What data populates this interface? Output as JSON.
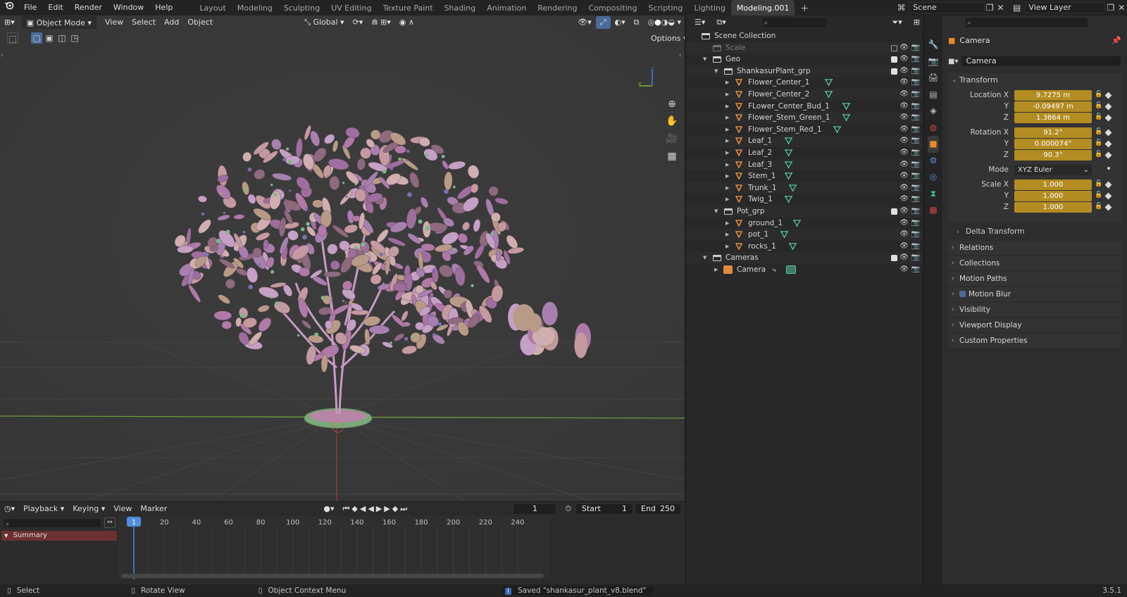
{
  "menu": {
    "file": "File",
    "edit": "Edit",
    "render": "Render",
    "window": "Window",
    "help": "Help"
  },
  "workspaces": [
    "Layout",
    "Modeling",
    "Sculpting",
    "UV Editing",
    "Texture Paint",
    "Shading",
    "Animation",
    "Rendering",
    "Compositing",
    "Scripting",
    "Lighting",
    "Modeling.001"
  ],
  "active_workspace": "Modeling.001",
  "scene_name": "Scene",
  "view_layer": "View Layer",
  "viewport": {
    "mode": "Object Mode",
    "menus": [
      "View",
      "Select",
      "Add",
      "Object"
    ],
    "transform_orientation": "Global",
    "options_label": "Options",
    "axis_x_label": "y",
    "axis_z_label": "z"
  },
  "timeline": {
    "menus": [
      "Playback",
      "Keying",
      "View",
      "Marker"
    ],
    "current_frame": "1",
    "start_label": "Start",
    "start_value": "1",
    "end_label": "End",
    "end_value": "250",
    "ruler": [
      "20",
      "40",
      "60",
      "80",
      "100",
      "120",
      "140",
      "160",
      "180",
      "200",
      "220",
      "240"
    ],
    "current_frame_marker": "1",
    "summary_label": "Summary"
  },
  "outliner": {
    "rows": [
      {
        "label": "Scene Collection",
        "type": "scene",
        "indent": 0
      },
      {
        "label": "Scale",
        "type": "collection-disabled",
        "indent": 1
      },
      {
        "label": "Geo",
        "type": "collection",
        "indent": 1
      },
      {
        "label": "ShankasurPlant_grp",
        "type": "collection",
        "indent": 2
      },
      {
        "label": "Flower_Center_1",
        "type": "mesh",
        "indent": 3
      },
      {
        "label": "Flower_Center_2",
        "type": "mesh",
        "indent": 3
      },
      {
        "label": "FLower_Center_Bud_1",
        "type": "mesh",
        "indent": 3
      },
      {
        "label": "Flower_Stem_Green_1",
        "type": "mesh",
        "indent": 3
      },
      {
        "label": "Flower_Stem_Red_1",
        "type": "mesh",
        "indent": 3
      },
      {
        "label": "Leaf_1",
        "type": "mesh",
        "indent": 3
      },
      {
        "label": "Leaf_2",
        "type": "mesh",
        "indent": 3
      },
      {
        "label": "Leaf_3",
        "type": "mesh",
        "indent": 3
      },
      {
        "label": "Stem_1",
        "type": "mesh",
        "indent": 3
      },
      {
        "label": "Trunk_1",
        "type": "mesh",
        "indent": 3
      },
      {
        "label": "Twig_1",
        "type": "mesh",
        "indent": 3
      },
      {
        "label": "Pot_grp",
        "type": "collection",
        "indent": 2
      },
      {
        "label": "ground_1",
        "type": "mesh",
        "indent": 3
      },
      {
        "label": "pot_1",
        "type": "mesh",
        "indent": 3
      },
      {
        "label": "rocks_1",
        "type": "mesh",
        "indent": 3
      },
      {
        "label": "Cameras",
        "type": "collection",
        "indent": 1
      },
      {
        "label": "Camera",
        "type": "camera",
        "indent": 2
      }
    ]
  },
  "properties": {
    "object_name": "Camera",
    "data_name": "Camera",
    "transform_label": "Transform",
    "location_label": "Location X",
    "location": [
      "9.7275 m",
      "-0.09497 m",
      "1.3864 m"
    ],
    "rotation_label": "Rotation X",
    "rotation": [
      "91.2°",
      "0.000074°",
      "90.3°"
    ],
    "mode_label": "Mode",
    "mode_value": "XYZ Euler",
    "scale_label": "Scale X",
    "scale": [
      "1.000",
      "1.000",
      "1.000"
    ],
    "axis_y": "Y",
    "axis_z": "Z",
    "delta_transform": "Delta Transform",
    "panels": [
      "Relations",
      "Collections",
      "Motion Paths",
      "Motion Blur",
      "Visibility",
      "Viewport Display",
      "Custom Properties"
    ]
  },
  "statusbar": {
    "select": "Select",
    "rotate": "Rotate View",
    "context": "Object Context Menu",
    "message": "Saved \"shankasur_plant_v8.blend\"",
    "version": "3.5.1"
  },
  "colors": {
    "accent_field": "#b38c22",
    "mesh_icon": "#e08a3c",
    "data_icon": "#57c29a",
    "timeline_cursor": "#4e8fe0"
  }
}
